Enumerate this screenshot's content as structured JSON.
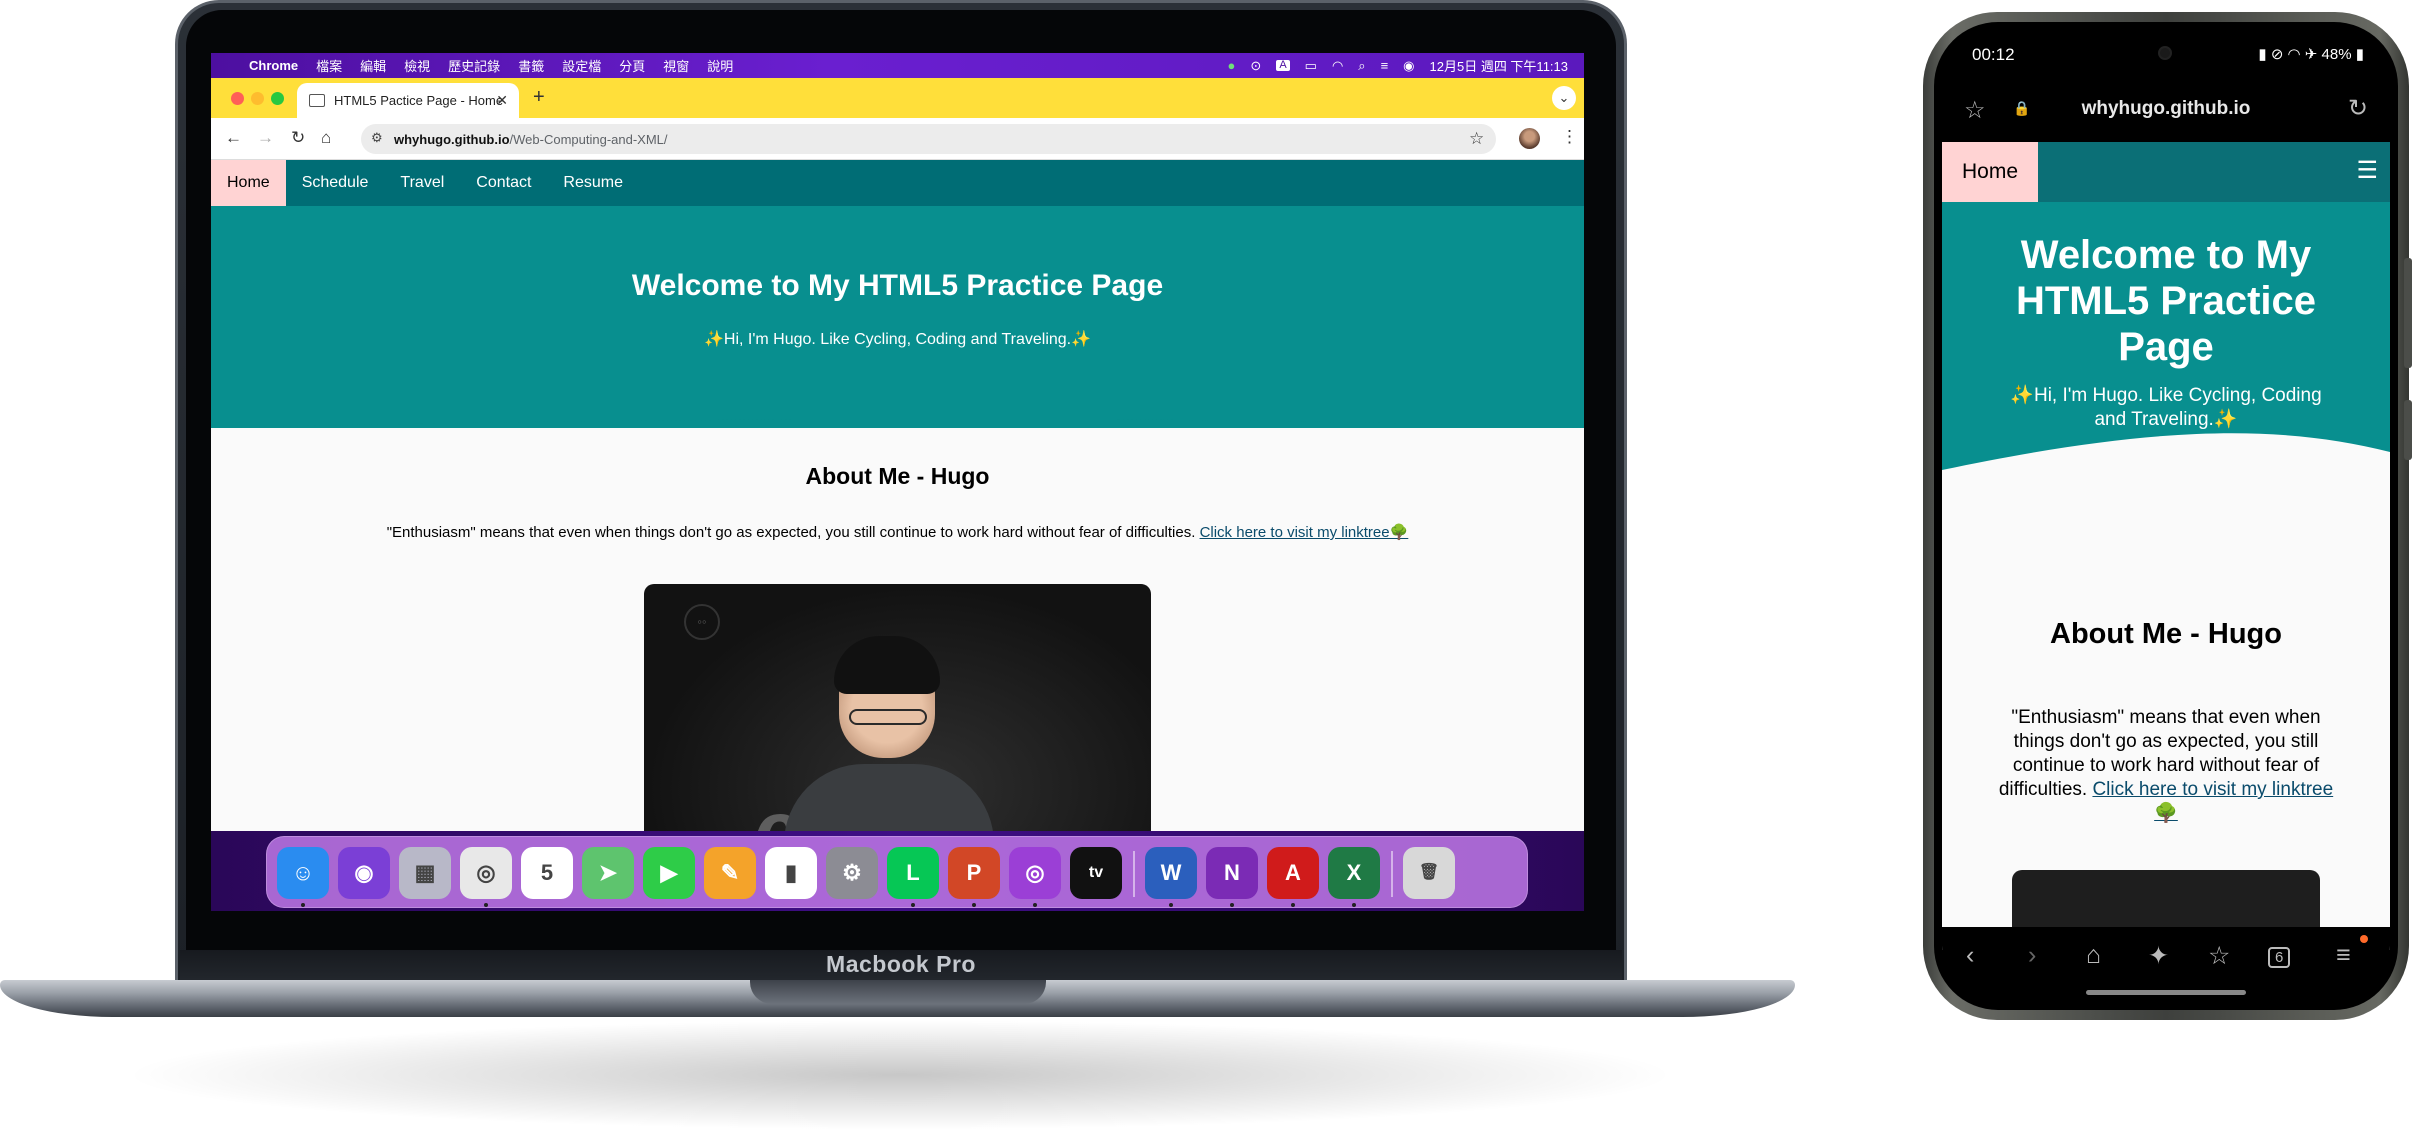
{
  "laptop": {
    "label": "Macbook Pro",
    "menubar": {
      "items": [
        "Chrome",
        "檔案",
        "編輯",
        "檢視",
        "歷史記錄",
        "書籤",
        "設定檔",
        "分頁",
        "視窗",
        "說明"
      ],
      "datetime": "12月5日 週四 下午11:13",
      "input_method": "A"
    },
    "browser": {
      "tab_title": "HTML5 Pactice Page - Home",
      "url_host": "whyhugo.github.io",
      "url_path": "/Web-Computing-and-XML/"
    },
    "page": {
      "nav": [
        "Home",
        "Schedule",
        "Travel",
        "Contact",
        "Resume"
      ],
      "hero_title": "Welcome to My HTML5 Practice Page",
      "hero_subtitle": "✨Hi, I'm Hugo. Like Cycling, Coding and Traveling.✨",
      "about_title": "About Me - Hugo",
      "about_text": "\"Enthusiasm\" means that even when things don't go as expected, you still continue to work hard without fear of difficulties. ",
      "about_link": "Click here to visit my linktree🌳"
    },
    "dock": [
      {
        "icon": "finder-icon",
        "color": "#2a8cf0",
        "glyph": "☺",
        "running": true
      },
      {
        "icon": "siri-icon",
        "color": "#7b3fd6",
        "glyph": "◉",
        "running": false
      },
      {
        "icon": "launchpad-icon",
        "color": "#b8b8c8",
        "glyph": "▦",
        "running": false
      },
      {
        "icon": "chrome-icon",
        "color": "#e8e8e8",
        "glyph": "◎",
        "running": true
      },
      {
        "icon": "calendar-icon",
        "color": "#ffffff",
        "glyph": "5",
        "running": false
      },
      {
        "icon": "maps-icon",
        "color": "#5ec46e",
        "glyph": "➤",
        "running": false
      },
      {
        "icon": "facetime-icon",
        "color": "#2ecc48",
        "glyph": "▶",
        "running": false
      },
      {
        "icon": "pages-icon",
        "color": "#f4a32a",
        "glyph": "✎",
        "running": false
      },
      {
        "icon": "numbers-icon",
        "color": "#ffffff",
        "glyph": "▮",
        "running": false
      },
      {
        "icon": "system-settings-icon",
        "color": "#8c8c94",
        "glyph": "⚙",
        "running": false
      },
      {
        "icon": "line-icon",
        "color": "#06c755",
        "glyph": "L",
        "running": true
      },
      {
        "icon": "powerpoint-icon",
        "color": "#d24726",
        "glyph": "P",
        "running": true
      },
      {
        "icon": "podcasts-icon",
        "color": "#9b3fd6",
        "glyph": "◎",
        "running": true
      },
      {
        "icon": "apple-tv-icon",
        "color": "#111111",
        "glyph": "tv",
        "running": false
      },
      {
        "icon": "word-icon",
        "color": "#2b5fbd",
        "glyph": "W",
        "running": true
      },
      {
        "icon": "onenote-icon",
        "color": "#7b2bb5",
        "glyph": "N",
        "running": true
      },
      {
        "icon": "acrobat-icon",
        "color": "#d01b1b",
        "glyph": "A",
        "running": true
      },
      {
        "icon": "excel-icon",
        "color": "#1f7a45",
        "glyph": "X",
        "running": true
      },
      {
        "icon": "trash-icon",
        "color": "#d8d8d8",
        "glyph": "🗑",
        "running": false
      }
    ]
  },
  "phone": {
    "status_time": "00:12",
    "battery": "48%",
    "url": "whyhugo.github.io",
    "nav_home": "Home",
    "hero_title": "Welcome to My HTML5 Practice Page",
    "hero_subtitle": "✨Hi, I'm Hugo. Like Cycling, Coding and Traveling.✨",
    "about_title": "About Me - Hugo",
    "about_text": "\"Enthusiasm\" means that even when things don't go as expected, you still continue to work hard without fear of difficulties. ",
    "about_link": "Click here to visit my linktree🌳",
    "tab_count": "6"
  }
}
